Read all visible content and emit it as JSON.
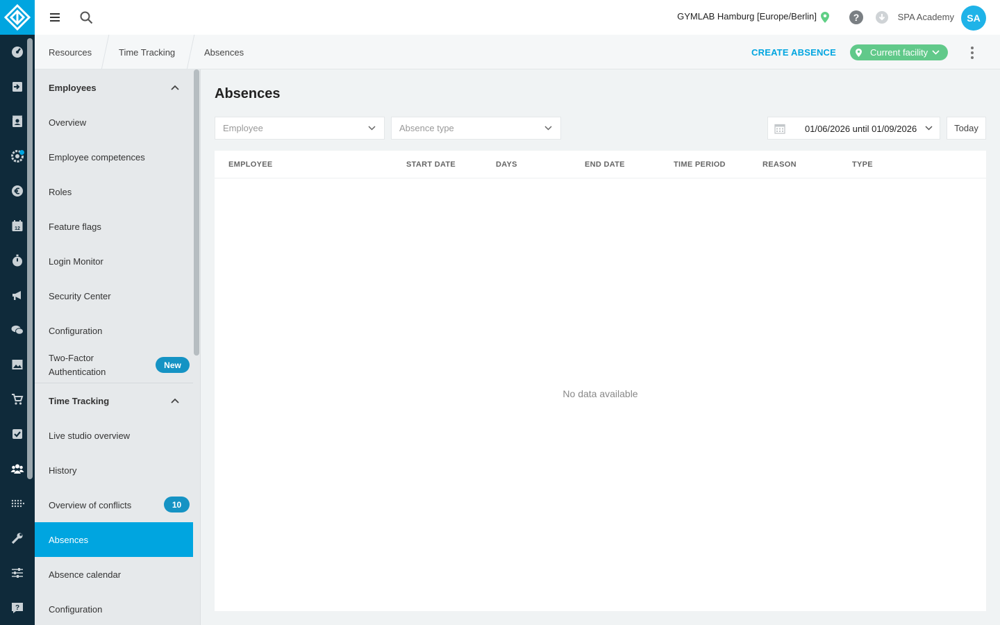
{
  "topbar": {
    "facility": "GYMLAB Hamburg [Europe/Berlin]",
    "user_name": "SPA Academy",
    "avatar_initials": "SA"
  },
  "breadcrumb": [
    "Resources",
    "Time Tracking",
    "Absences"
  ],
  "actions": {
    "create_absence": "CREATE ABSENCE",
    "current_facility": "Current facility"
  },
  "sidenav": {
    "groups": [
      {
        "title": "Employees",
        "items": [
          "Overview",
          "Employee competences",
          "Roles",
          "Feature flags",
          "Login Monitor",
          "Security Center",
          "Configuration",
          "Two-Factor Authentication"
        ]
      },
      {
        "title": "Time Tracking",
        "items": [
          "Live studio overview",
          "History",
          "Overview of conflicts",
          "Absences",
          "Absence calendar",
          "Configuration"
        ]
      }
    ],
    "badges": {
      "two_factor": "New",
      "conflicts": "10"
    },
    "active_item": "Absences"
  },
  "main": {
    "title": "Absences",
    "filters": {
      "employee_placeholder": "Employee",
      "absence_type_placeholder": "Absence type",
      "date_range": "01/06/2026 until 01/09/2026",
      "today_label": "Today"
    },
    "table": {
      "columns": [
        "EMPLOYEE",
        "START DATE",
        "DAYS",
        "END DATE",
        "TIME PERIOD",
        "REASON",
        "TYPE"
      ],
      "rows": [],
      "empty_message": "No data available"
    }
  },
  "colors": {
    "accent": "#00a5e0",
    "rail": "#0f2a3a",
    "facility_pill": "#61c98a"
  },
  "icons": {
    "rail": [
      "dashboard-icon",
      "checkin-icon",
      "contacts-icon",
      "settings-gear-icon",
      "euro-icon",
      "calendar-icon",
      "stopwatch-icon",
      "megaphone-icon",
      "chat-icon",
      "image-icon",
      "cart-icon",
      "checkbox-icon",
      "people-icon",
      "dots-grid-icon",
      "wrench-icon",
      "sliders-icon",
      "help-icon"
    ]
  }
}
